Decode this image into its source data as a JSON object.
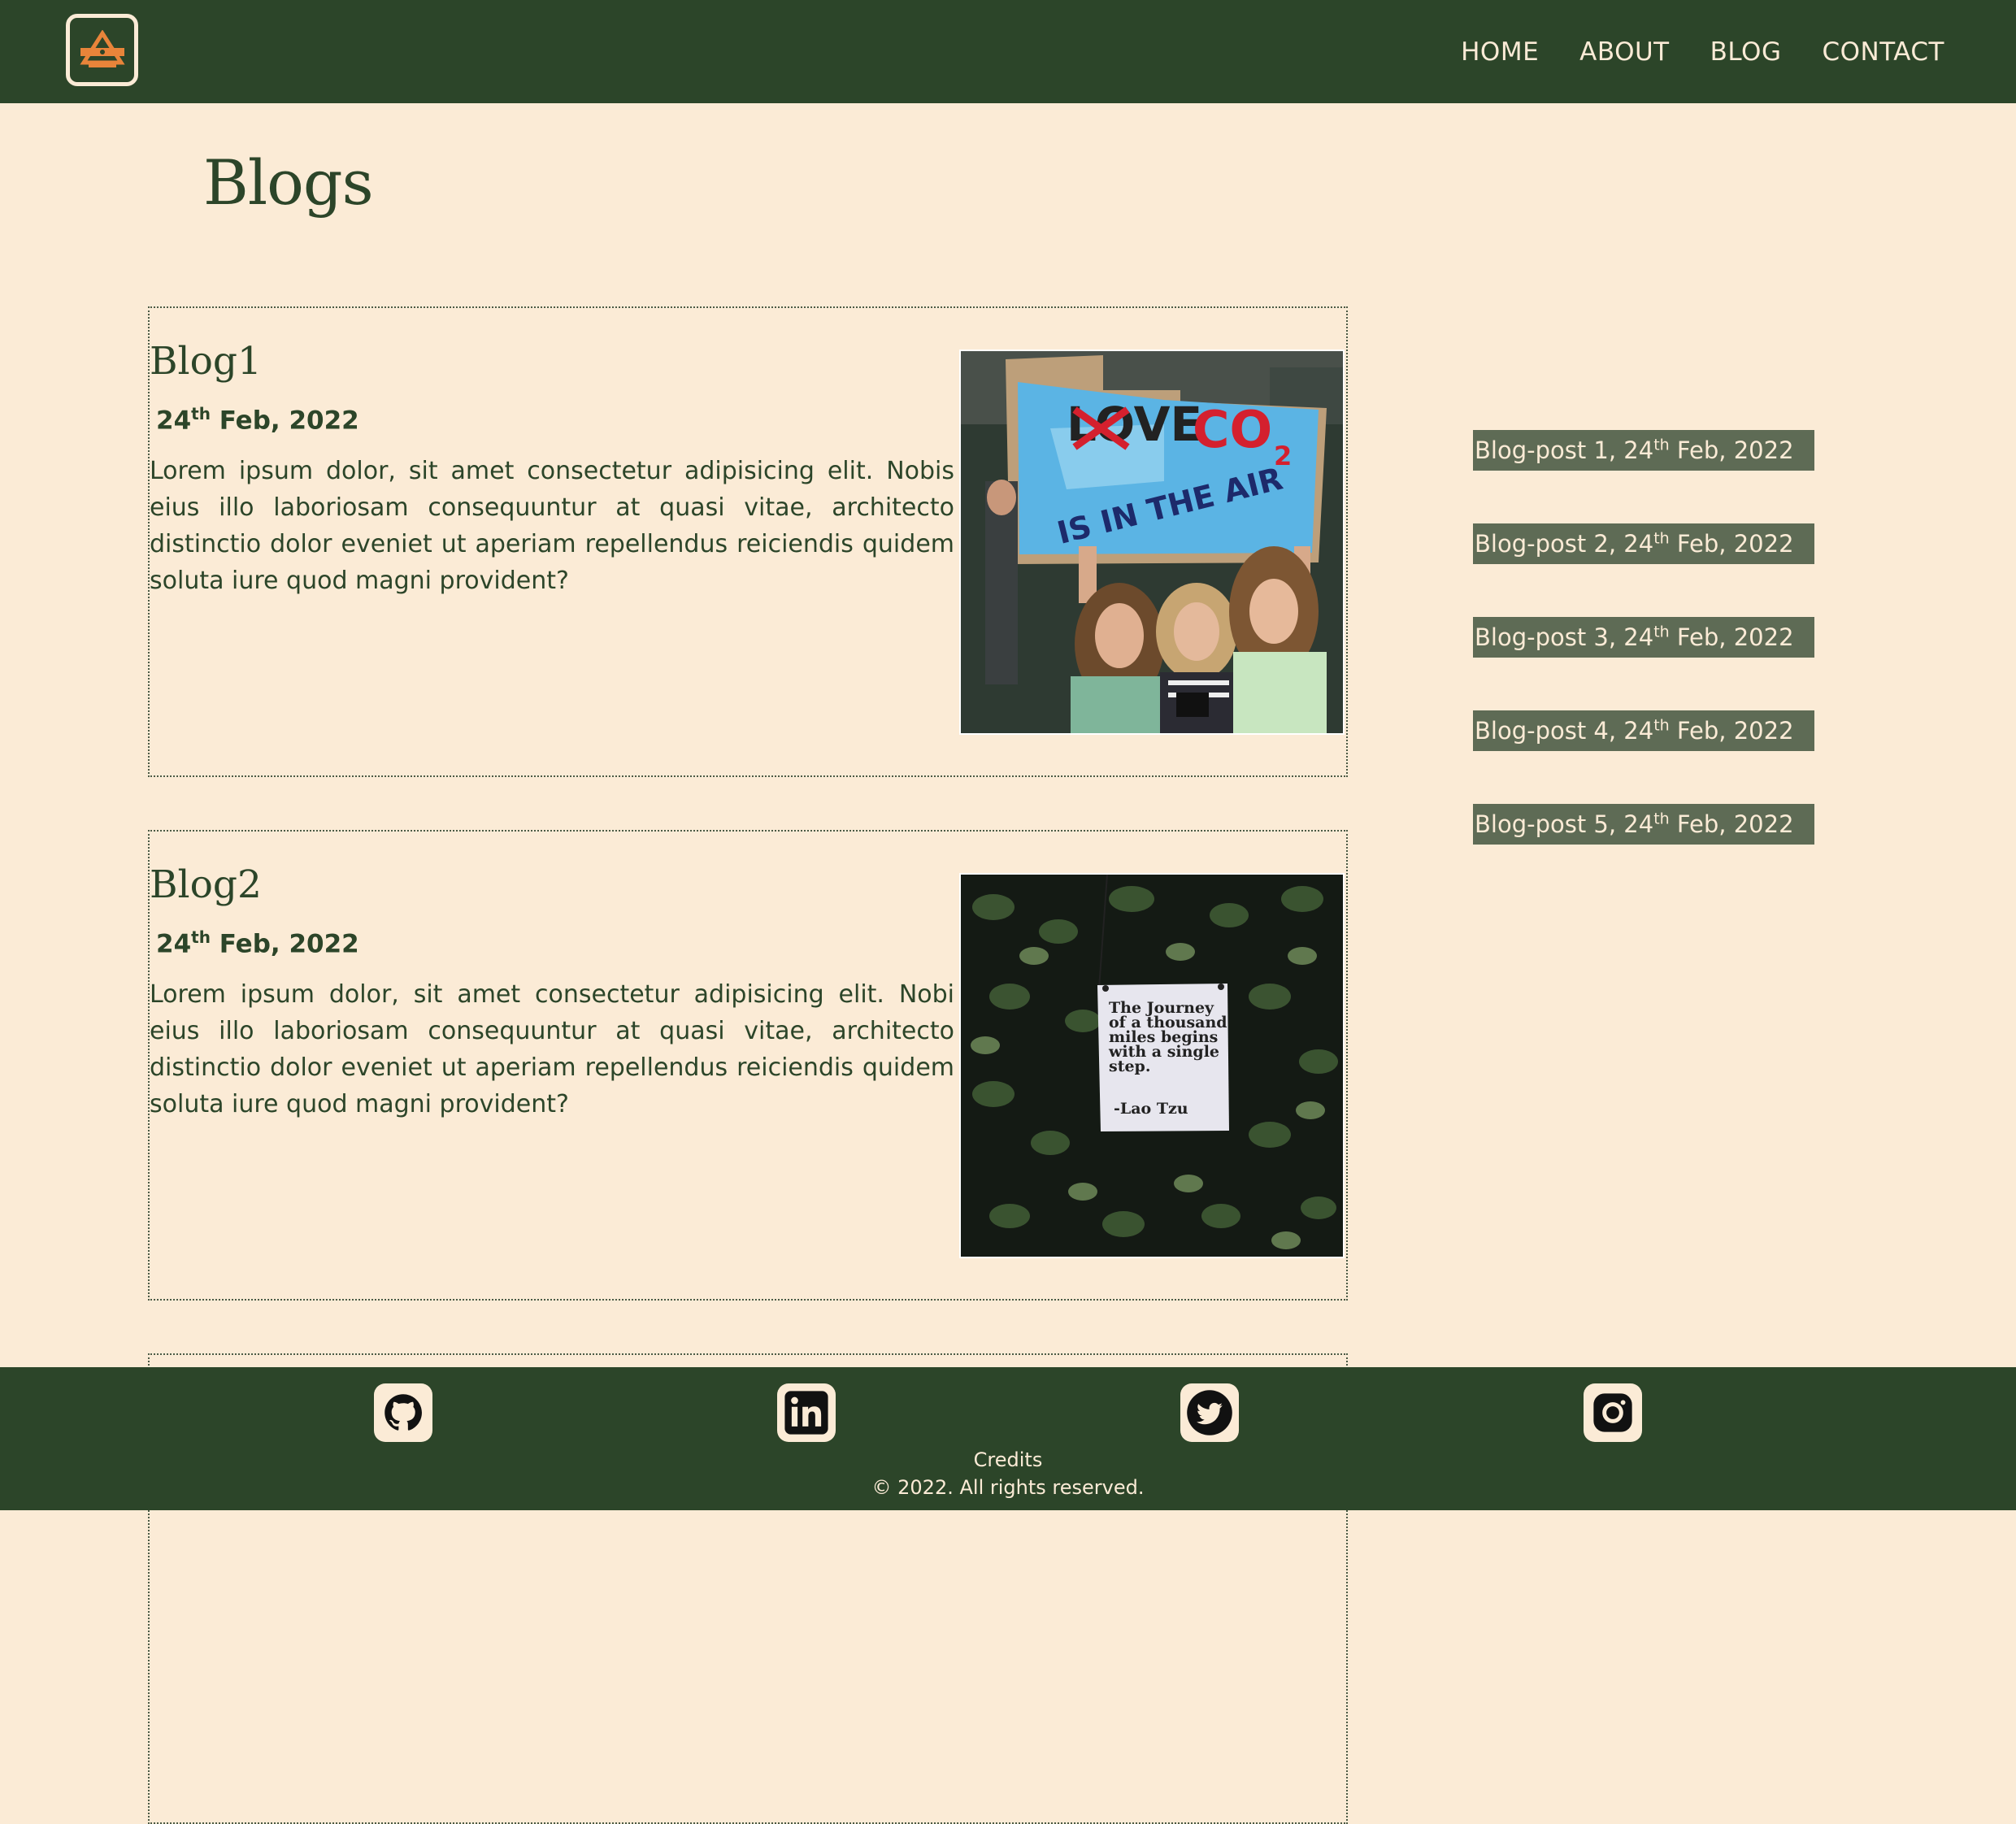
{
  "header": {
    "nav": [
      {
        "label": "HOME"
      },
      {
        "label": "ABOUT"
      },
      {
        "label": "BLOG"
      },
      {
        "label": "CONTACT"
      }
    ]
  },
  "page": {
    "title": "Blogs"
  },
  "posts": [
    {
      "title": "Blog1",
      "date_day": "24",
      "date_suffix": "th",
      "date_rest": " Feb, 2022",
      "body": "Lorem ipsum dolor, sit amet consectetur adipisicing elit. Nobis eius illo laboriosam consequuntur at quasi vitae, architecto distinctio dolor eveniet ut aperiam repellendus reiciendis quidem soluta iure quod magni provident?",
      "image": {
        "sign_line1_struck": "LOVE",
        "sign_line1": "CO",
        "sign_sub": "2",
        "sign_line2": "IS IN THE AIR"
      }
    },
    {
      "title": "Blog2",
      "date_day": "24",
      "date_suffix": "th",
      "date_rest": " Feb, 2022",
      "body": "Lorem ipsum dolor, sit amet consectetur adipisicing elit. Nobi eius illo laboriosam consequuntur at quasi vitae, architecto distinctio dolor eveniet ut aperiam repellendus reiciendis quidem soluta iure quod magni provident?",
      "image": {
        "note_lines": [
          "The Journey",
          "of a thousand",
          "miles begins",
          "with a single",
          "step."
        ],
        "note_author": "-Lao Tzu"
      }
    }
  ],
  "sidebar": [
    {
      "prefix": "Blog-post 1, 24",
      "sup": "th",
      "suffix": " Feb, 2022"
    },
    {
      "prefix": "Blog-post 2, 24",
      "sup": "th",
      "suffix": " Feb, 2022"
    },
    {
      "prefix": "Blog-post 3, 24",
      "sup": "th",
      "suffix": " Feb, 2022"
    },
    {
      "prefix": "Blog-post 4, 24",
      "sup": "th",
      "suffix": " Feb, 2022"
    },
    {
      "prefix": "Blog-post 5, 24",
      "sup": "th",
      "suffix": " Feb, 2022"
    }
  ],
  "footer": {
    "social": [
      "github-icon",
      "linkedin-icon",
      "twitter-icon",
      "instagram-icon"
    ],
    "credits": "Credits",
    "copyright": "© 2022. All rights reserved."
  },
  "colors": {
    "primary": "#2c4529",
    "background": "#fbebd6",
    "sidebar_item": "#5e6b55",
    "logo_accent": "#e8843a"
  }
}
